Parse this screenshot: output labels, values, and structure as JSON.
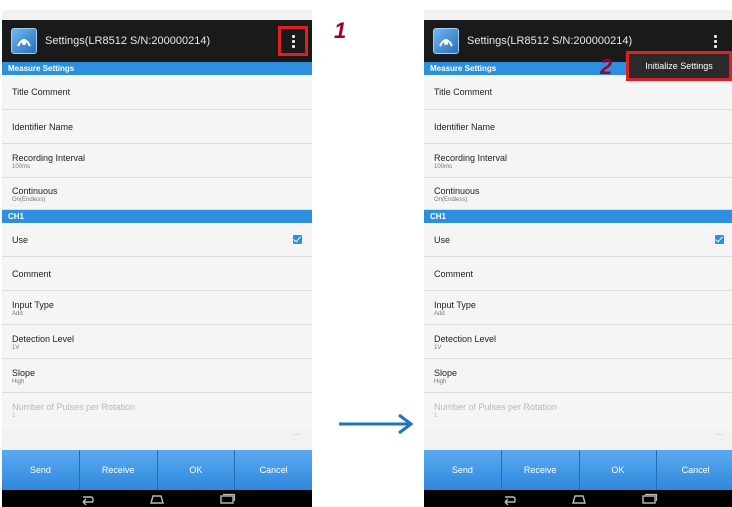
{
  "title": "Settings(LR8512 S/N:200000214)",
  "steps": {
    "one": "1",
    "two": "2"
  },
  "menu": {
    "initialize": "Initialize Settings"
  },
  "sections": {
    "measure": "Measure Settings",
    "ch1": "CH1"
  },
  "measure_rows": {
    "title_comment": "Title Comment",
    "identifier_name": "Identifier Name",
    "recording_interval": {
      "label": "Recording Interval",
      "value": "100ms"
    },
    "continuous": {
      "label": "Continuous",
      "value": "On(Endless)"
    }
  },
  "ch1_rows": {
    "use": {
      "label": "Use",
      "checked": true
    },
    "comment": "Comment",
    "input_type": {
      "label": "Input Type",
      "value": "Add"
    },
    "detection_level": {
      "label": "Detection Level",
      "value": "1V"
    },
    "slope": {
      "label": "Slope",
      "value": "High"
    },
    "pulses": {
      "label": "Number of Pulses per Rotation",
      "value": "1"
    }
  },
  "more_indicator": "...",
  "buttons": {
    "send": "Send",
    "receive": "Receive",
    "ok": "OK",
    "cancel": "Cancel"
  },
  "icons": [
    "app-icon",
    "overflow-menu-icon",
    "checkbox-checked-icon",
    "back-icon",
    "home-icon",
    "recents-icon",
    "arrow-right-icon"
  ],
  "colors": {
    "accent": "#2d8fe0",
    "highlight": "#e02020",
    "step": "#a0002a",
    "arrow": "#1f73bf"
  }
}
